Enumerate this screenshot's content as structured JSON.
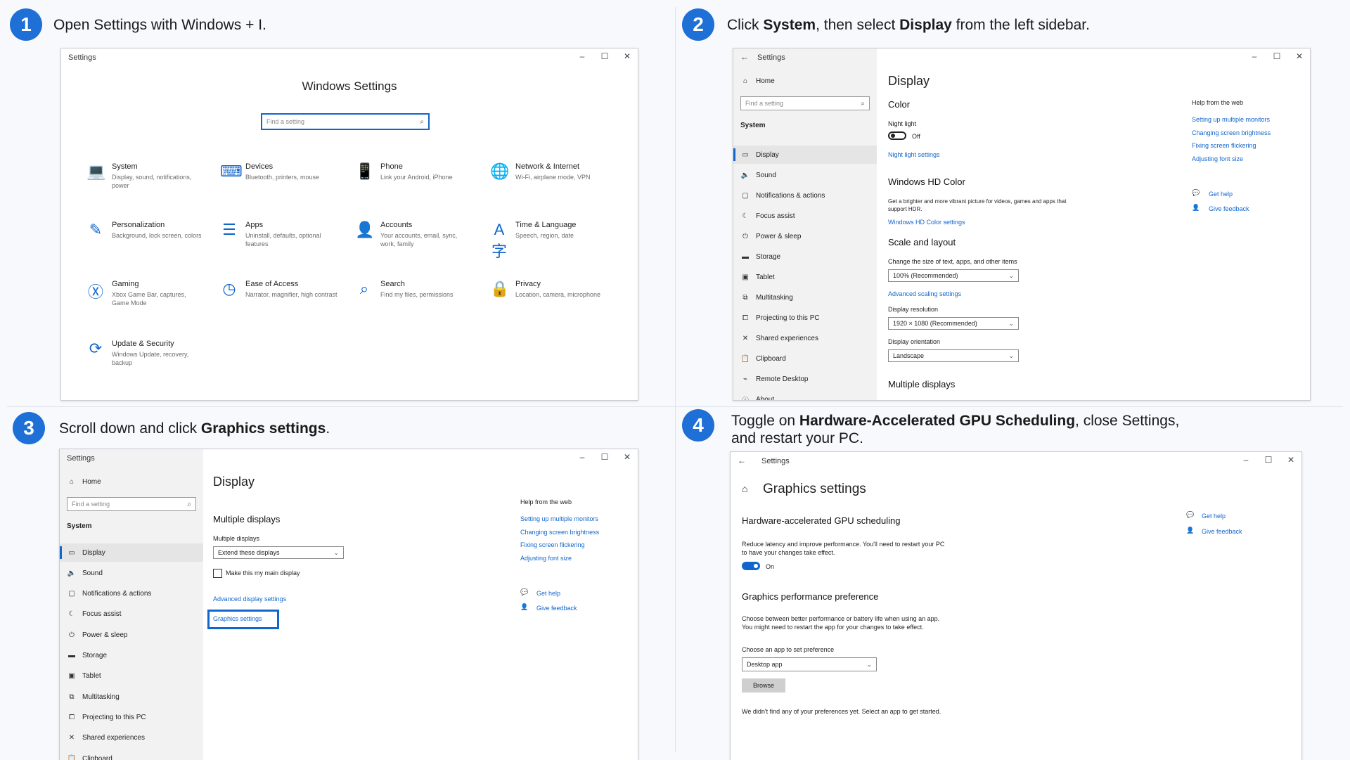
{
  "colors": {
    "accent": "#1166cc",
    "step_badge": "#1e6fd6"
  },
  "steps": [
    {
      "number": "1",
      "pre": "Open Settings with Windows + I.",
      "b1": "",
      "mid": "",
      "b2": "",
      "post": ""
    },
    {
      "number": "2",
      "pre": "Click ",
      "b1": "System",
      "mid": ", then select ",
      "b2": "Display",
      "post": " from the left sidebar."
    },
    {
      "number": "3",
      "pre": "Scroll down and click ",
      "b1": "Graphics settings",
      "post": "."
    },
    {
      "number": "4",
      "pre": "Toggle on ",
      "b1": "Hardware-Accelerated GPU Scheduling",
      "post": ", close Settings,",
      "line2": "and restart your PC."
    }
  ],
  "win_controls": {
    "minimize": "–",
    "maximize": "☐",
    "close": "✕",
    "back": "←"
  },
  "panel1": {
    "titlebar": "Settings",
    "heading": "Windows Settings",
    "search_placeholder": "Find a setting",
    "tiles": [
      {
        "icon": "laptop-icon",
        "glyph": "💻",
        "title": "System",
        "sub": "Display, sound, notifications, power"
      },
      {
        "icon": "devices-icon",
        "glyph": "⌨",
        "title": "Devices",
        "sub": "Bluetooth, printers, mouse"
      },
      {
        "icon": "phone-icon",
        "glyph": "📱",
        "title": "Phone",
        "sub": "Link your Android, iPhone"
      },
      {
        "icon": "globe-icon",
        "glyph": "🌐",
        "title": "Network & Internet",
        "sub": "Wi-Fi, airplane mode, VPN"
      },
      {
        "icon": "personalization-icon",
        "glyph": "✎",
        "title": "Personalization",
        "sub": "Background, lock screen, colors"
      },
      {
        "icon": "apps-icon",
        "glyph": "☰",
        "title": "Apps",
        "sub": "Uninstall, defaults, optional features"
      },
      {
        "icon": "person-icon",
        "glyph": "👤",
        "title": "Accounts",
        "sub": "Your accounts, email, sync, work, family"
      },
      {
        "icon": "language-icon",
        "glyph": "A字",
        "title": "Time & Language",
        "sub": "Speech, region, date"
      },
      {
        "icon": "xbox-icon",
        "glyph": "Ⓧ",
        "title": "Gaming",
        "sub": "Xbox Game Bar, captures, Game Mode"
      },
      {
        "icon": "ease-of-access-icon",
        "glyph": "◷",
        "title": "Ease of Access",
        "sub": "Narrator, magnifier, high contrast"
      },
      {
        "icon": "search-icon",
        "glyph": "⌕",
        "title": "Search",
        "sub": "Find my files, permissions"
      },
      {
        "icon": "lock-icon",
        "glyph": "🔒",
        "title": "Privacy",
        "sub": "Location, camera, microphone"
      },
      {
        "icon": "update-icon",
        "glyph": "⟳",
        "title": "Update & Security",
        "sub": "Windows Update, recovery, backup"
      }
    ]
  },
  "panel2": {
    "titlebar": "Settings",
    "home": "Home",
    "search_placeholder": "Find a setting",
    "section": "System",
    "nav": [
      {
        "icon": "monitor-icon",
        "glyph": "▭",
        "label": "Display"
      },
      {
        "icon": "speaker-icon",
        "glyph": "🔈",
        "label": "Sound"
      },
      {
        "icon": "notification-icon",
        "glyph": "▢",
        "label": "Notifications & actions"
      },
      {
        "icon": "moon-icon",
        "glyph": "☾",
        "label": "Focus assist"
      },
      {
        "icon": "power-icon",
        "glyph": "⏻",
        "label": "Power & sleep"
      },
      {
        "icon": "storage-icon",
        "glyph": "▬",
        "label": "Storage"
      },
      {
        "icon": "tablet-icon",
        "glyph": "▣",
        "label": "Tablet"
      },
      {
        "icon": "multitasking-icon",
        "glyph": "⧉",
        "label": "Multitasking"
      },
      {
        "icon": "projector-icon",
        "glyph": "⧠",
        "label": "Projecting to this PC"
      },
      {
        "icon": "shared-icon",
        "glyph": "✕",
        "label": "Shared experiences"
      },
      {
        "icon": "clipboard-icon",
        "glyph": "📋",
        "label": "Clipboard"
      },
      {
        "icon": "remote-icon",
        "glyph": "⌁",
        "label": "Remote Desktop"
      },
      {
        "icon": "info-icon",
        "glyph": "ⓘ",
        "label": "About"
      }
    ],
    "page_title": "Display",
    "color_header": "Color",
    "night_light_label": "Night light",
    "night_light_state": "Off",
    "night_light_link": "Night light settings",
    "hd_header": "Windows HD Color",
    "hd_desc": "Get a brighter and more vibrant picture for videos, games and apps that support HDR.",
    "hd_link": "Windows HD Color settings",
    "scale_header": "Scale and layout",
    "scale_label": "Change the size of text, apps, and other items",
    "scale_value": "100% (Recommended)",
    "scale_link": "Advanced scaling settings",
    "res_label": "Display resolution",
    "res_value": "1920 × 1080 (Recommended)",
    "orient_label": "Display orientation",
    "orient_value": "Landscape",
    "multi_header": "Multiple displays",
    "help_header": "Help from the web",
    "help_links": [
      "Setting up multiple monitors",
      "Changing screen brightness",
      "Fixing screen flickering",
      "Adjusting font size"
    ],
    "get_help": "Get help",
    "give_feedback": "Give feedback"
  },
  "panel3": {
    "titlebar": "Settings",
    "home": "Home",
    "search_placeholder": "Find a setting",
    "section": "System",
    "nav": [
      "Display",
      "Sound",
      "Notifications & actions",
      "Focus assist",
      "Power & sleep",
      "Storage",
      "Tablet",
      "Multitasking",
      "Projecting to this PC",
      "Shared experiences",
      "Clipboard"
    ],
    "page_title": "Display",
    "multi_header": "Multiple displays",
    "multi_label": "Multiple displays",
    "multi_value": "Extend these displays",
    "main_display_label": "Make this my main display",
    "adv_link": "Advanced display settings",
    "graphics_link": "Graphics settings",
    "help_header": "Help from the web",
    "help_links": [
      "Setting up multiple monitors",
      "Changing screen brightness",
      "Fixing screen flickering",
      "Adjusting font size"
    ],
    "get_help": "Get help",
    "give_feedback": "Give feedback"
  },
  "panel4": {
    "titlebar": "Settings",
    "page_title": "Graphics settings",
    "gpu_header": "Hardware-accelerated GPU scheduling",
    "gpu_desc_1": "Reduce latency and improve performance. You'll need to restart your PC",
    "gpu_desc_2": "to have your changes take effect.",
    "gpu_state": "On",
    "perf_header": "Graphics performance preference",
    "perf_desc_1": "Choose between better performance or battery life when using an app.",
    "perf_desc_2": "You might need to restart the app for your changes to take effect.",
    "choose_label": "Choose an app to set preference",
    "choose_value": "Desktop app",
    "browse": "Browse",
    "empty_msg": "We didn't find any of your preferences yet. Select an app to get started.",
    "get_help": "Get help",
    "give_feedback": "Give feedback"
  }
}
